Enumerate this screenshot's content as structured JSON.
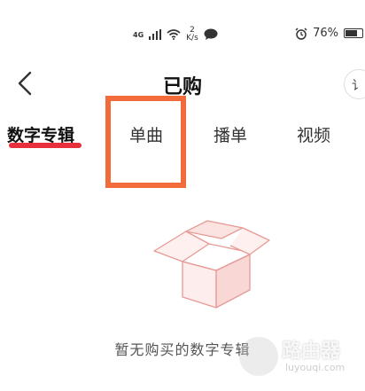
{
  "status_bar": {
    "signal_label": "4G",
    "net_speed_value": "2",
    "net_speed_unit": "K/s",
    "battery_percent": "76%",
    "battery_level": 0.76,
    "icons": [
      "signal-icon",
      "wifi-icon",
      "chat-bubble-icon",
      "alarm-icon",
      "battery-icon"
    ]
  },
  "header": {
    "title": "已购",
    "right_button_text": "讠"
  },
  "tabs": [
    {
      "label": "数字专辑",
      "active": true
    },
    {
      "label": "单曲",
      "active": false
    },
    {
      "label": "播单",
      "active": false
    },
    {
      "label": "视频",
      "active": false
    }
  ],
  "empty_state": {
    "message": "暂无购买的数字专辑",
    "icon": "empty-box-icon"
  },
  "watermark": {
    "title": "路由器",
    "subtitle": "luyouqi.com"
  },
  "colors": {
    "accent": "#e8303d",
    "highlight": "#f26b3a",
    "box_stroke": "#e79a95"
  }
}
